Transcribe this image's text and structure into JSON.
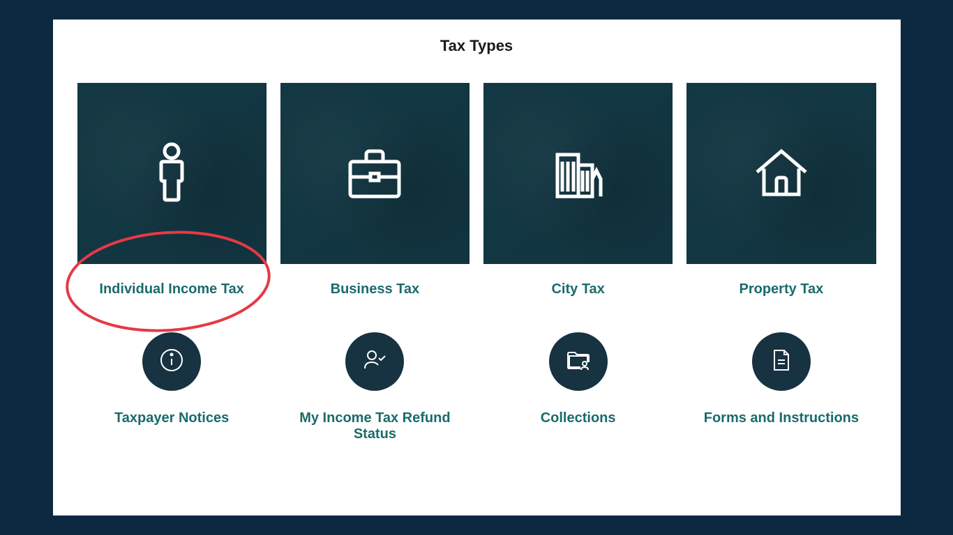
{
  "page": {
    "title": "Tax Types"
  },
  "cards": [
    {
      "label": "Individual Income Tax",
      "icon": "person"
    },
    {
      "label": "Business Tax",
      "icon": "briefcase"
    },
    {
      "label": "City Tax",
      "icon": "buildings"
    },
    {
      "label": "Property Tax",
      "icon": "house"
    }
  ],
  "icon_items": [
    {
      "label": "Taxpayer Notices",
      "icon": "info"
    },
    {
      "label": "My Income Tax Refund Status",
      "icon": "person-check"
    },
    {
      "label": "Collections",
      "icon": "folder-person"
    },
    {
      "label": "Forms and Instructions",
      "icon": "document"
    }
  ],
  "annotation": {
    "type": "red-circle",
    "target": "card-0"
  }
}
